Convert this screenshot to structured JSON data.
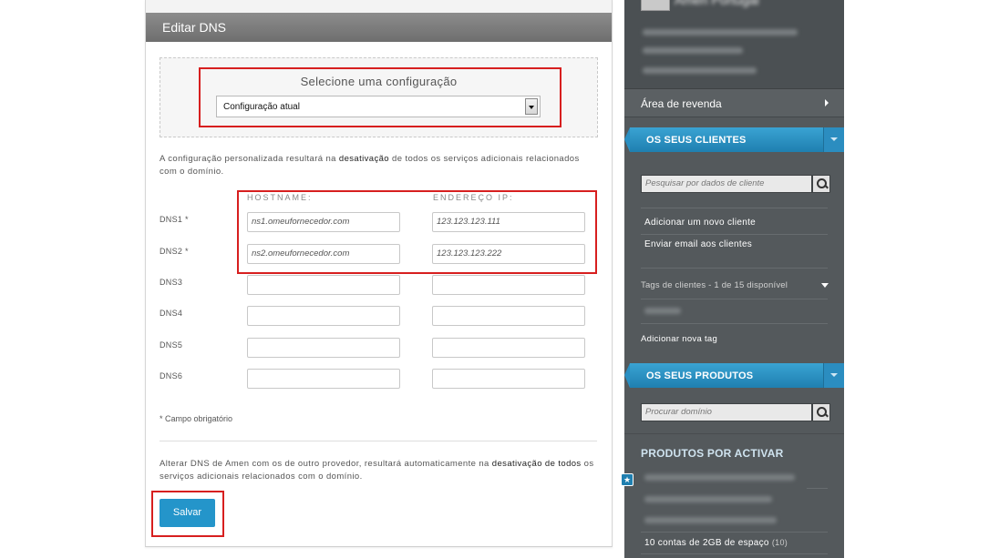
{
  "main": {
    "header_title": "Editar DNS",
    "config": {
      "title": "Selecione uma configuração",
      "selected": "Configuração atual"
    },
    "notice_before": "A configuração personalizada resultará na ",
    "notice_bold": "desativação",
    "notice_after": " de todos os serviços adicionais relacionados com o domínio.",
    "col_hostname": "HOSTNAME:",
    "col_ip": "ENDEREÇO IP:",
    "rows": [
      {
        "label": "DNS1 *",
        "hostname": "ns1.omeufornecedor.com",
        "ip": "123.123.123.111"
      },
      {
        "label": "DNS2 *",
        "hostname": "ns2.omeufornecedor.com",
        "ip": "123.123.123.222"
      },
      {
        "label": "DNS3",
        "hostname": "",
        "ip": ""
      },
      {
        "label": "DNS4",
        "hostname": "",
        "ip": ""
      },
      {
        "label": "DNS5",
        "hostname": "",
        "ip": ""
      },
      {
        "label": "DNS6",
        "hostname": "",
        "ip": ""
      }
    ],
    "required_note": "* Campo obrigatório",
    "notice2_before": "Alterar DNS de Amen com os de outro provedor, resultará automaticamente na ",
    "notice2_bold": "desativação de todos",
    "notice2_after": " os serviços adicionais relacionados com o domínio.",
    "save_label": "Salvar"
  },
  "sidebar": {
    "user_name": "Amen Portugal",
    "reseller_label": "Área de revenda",
    "clients_title": "OS SEUS CLIENTES",
    "clients_search_placeholder": "Pesquisar por dados de cliente",
    "add_client": "Adicionar um novo cliente",
    "email_clients": "Enviar email aos clientes",
    "tags_label": "Tags de clientes - 1 de 15 disponível",
    "add_tag": "Adicionar nova tag",
    "products_title": "OS SEUS PRODUTOS",
    "domain_search_placeholder": "Procurar domínio",
    "pending_title": "PRODUTOS POR ACTIVAR",
    "pending_item_label": "10 contas de 2GB de espaço",
    "pending_item_count": "(10)"
  },
  "colors": {
    "accent_blue": "#2495ca",
    "highlight_red": "#d71f1f",
    "sidebar_bg": "#54595c"
  }
}
